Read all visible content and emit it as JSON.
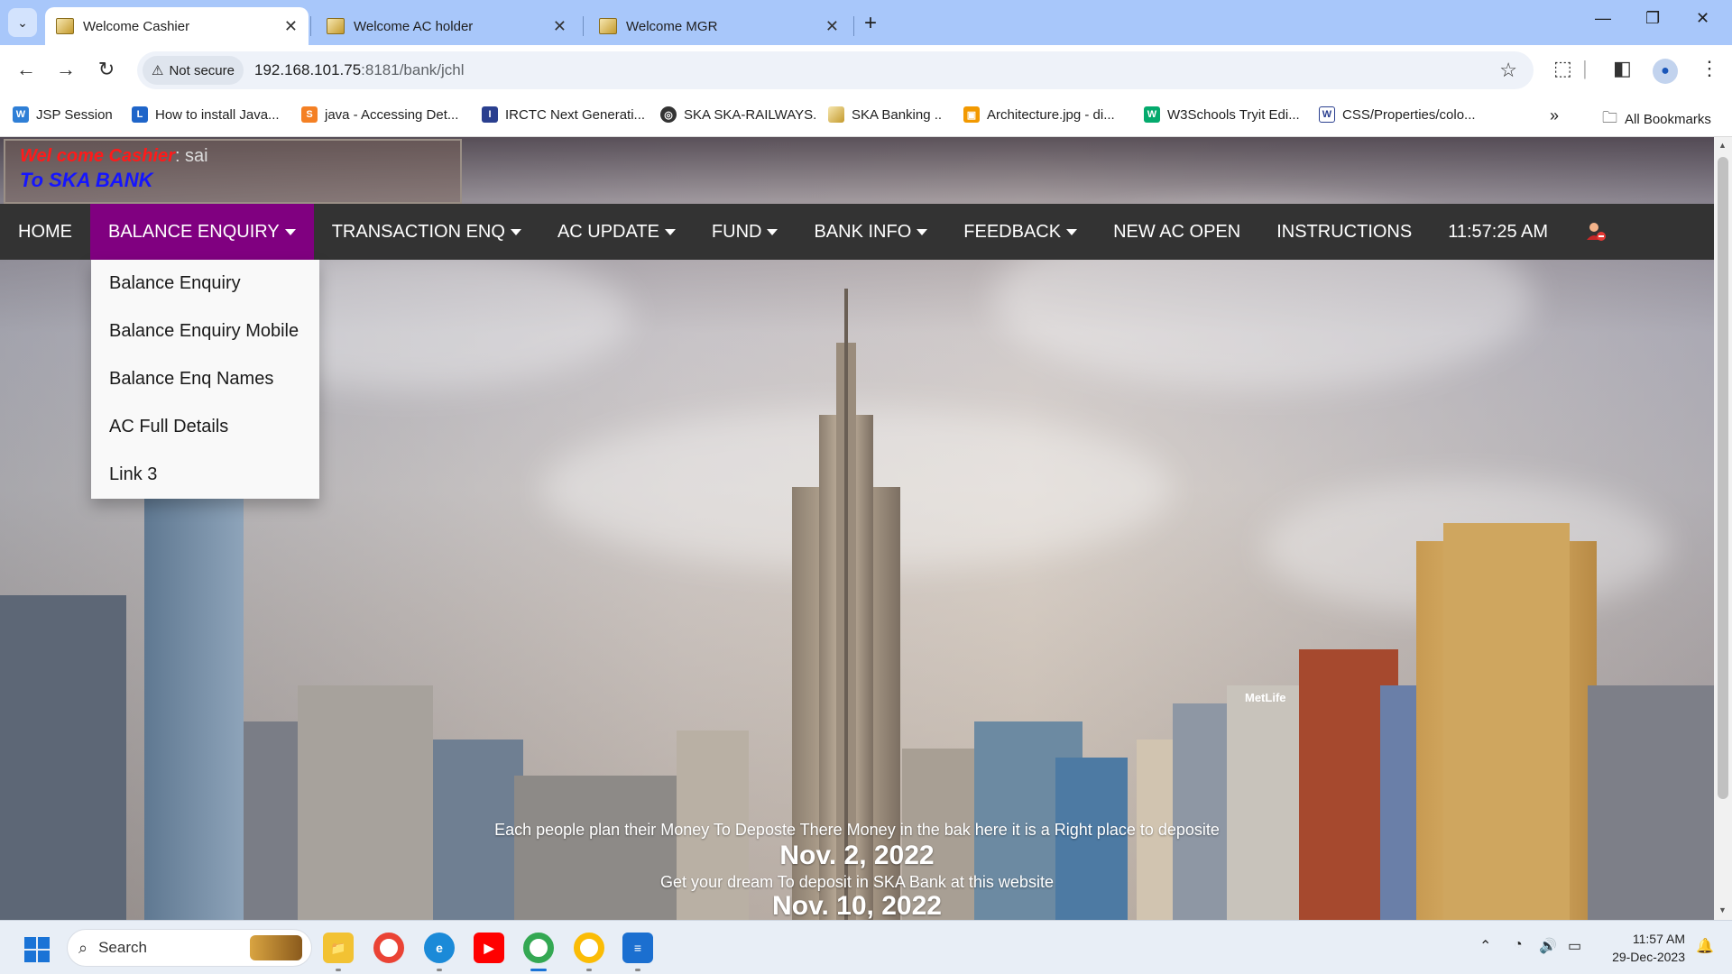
{
  "browser": {
    "tabs": [
      {
        "title": "Welcome Cashier",
        "active": true
      },
      {
        "title": "Welcome AC holder",
        "active": false
      },
      {
        "title": "Welcome MGR",
        "active": false
      }
    ],
    "security_label": "Not secure",
    "url_host": "192.168.101.75",
    "url_path": ":8181/bank/jchl",
    "bookmarks": [
      {
        "label": "JSP Session"
      },
      {
        "label": "How to install Java..."
      },
      {
        "label": "java - Accessing Det..."
      },
      {
        "label": "IRCTC Next Generati..."
      },
      {
        "label": "SKA SKA-RAILWAYS."
      },
      {
        "label": "SKA Banking .."
      },
      {
        "label": "Architecture.jpg - di..."
      },
      {
        "label": "W3Schools Tryit Edi..."
      },
      {
        "label": "CSS/Properties/colo..."
      }
    ],
    "all_bookmarks": "All Bookmarks"
  },
  "page": {
    "welcome": {
      "greeting": "Wel come Cashier",
      "user": ": sai",
      "bank": "To SKA BANK"
    },
    "nav": {
      "home": "HOME",
      "balance_enquiry": "BALANCE ENQUIRY",
      "transaction_enq": "TRANSACTION ENQ",
      "ac_update": "AC UPDATE",
      "fund": "FUND",
      "bank_info": "BANK INFO",
      "feedback": "FEEDBACK",
      "new_ac_open": "NEW AC OPEN",
      "instructions": "INSTRUCTIONS",
      "clock": "11:57:25 AM"
    },
    "dropdown": [
      "Balance Enquiry",
      "Balance Enquiry Mobile",
      "Balance Enq Names",
      "AC Full Details",
      "Link 3"
    ],
    "captions": {
      "line1": "Each people plan their Money To Deposte There Money in the bak here it is a Right place to deposite",
      "date1": "Nov. 2, 2022",
      "line2": "Get your dream To deposit in SKA Bank at this website",
      "date2": "Nov. 10, 2022"
    },
    "skyline_sign": "MetLife"
  },
  "taskbar": {
    "search_placeholder": "Search",
    "time": "11:57 AM",
    "date": "29-Dec-2023"
  },
  "colors": {
    "navbar": "#333333",
    "nav_active": "#800080",
    "greeting_red": "#ff1a1a",
    "bank_blue": "#1515ff"
  }
}
